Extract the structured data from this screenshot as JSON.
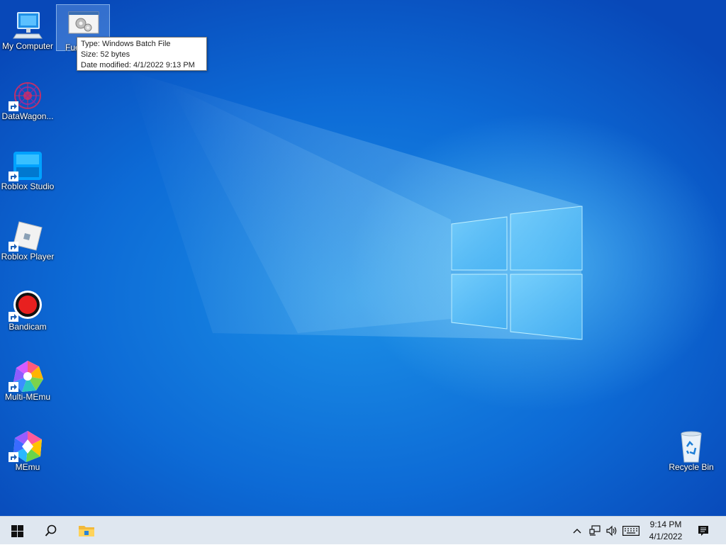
{
  "desktop": {
    "icons": [
      {
        "label": "My Computer"
      },
      {
        "label": "Fue"
      },
      {
        "label": "DataWagon..."
      },
      {
        "label": "Roblox Studio"
      },
      {
        "label": "Roblox Player"
      },
      {
        "label": "Bandicam"
      },
      {
        "label": "Multi-MEmu"
      },
      {
        "label": "MEmu"
      },
      {
        "label": "Recycle Bin"
      }
    ],
    "tooltip": {
      "type": "Type: Windows Batch File",
      "size": "Size: 52 bytes",
      "modified": "Date modified: 4/1/2022 9:13 PM"
    }
  },
  "taskbar": {
    "clock_time": "9:14 PM",
    "clock_date": "4/1/2022",
    "icons": [
      "windows-start-icon",
      "search-icon",
      "file-explorer-icon",
      "chevron-up-icon",
      "network-icon",
      "volume-icon",
      "keyboard-icon",
      "notification-icon"
    ]
  },
  "colors": {
    "wallpaper": "#0d6bd6",
    "taskbar": "#dfe7f0"
  }
}
